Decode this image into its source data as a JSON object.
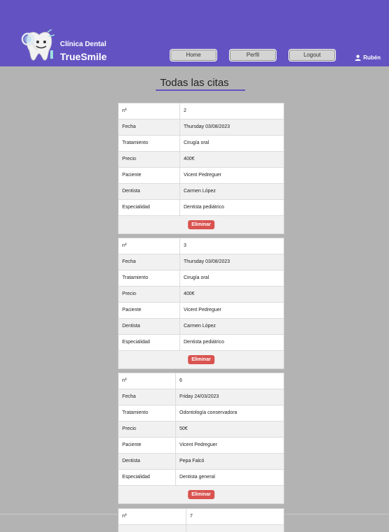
{
  "brand": {
    "line1": "Clínica Dental",
    "line2": "TrueSmile"
  },
  "nav": {
    "home": "Home",
    "profile": "Perfil",
    "logout": "Logout",
    "user": "Rubén"
  },
  "page": {
    "title": "Todas las citas"
  },
  "labels": {
    "num": "nº",
    "date": "Fecha",
    "treatment": "Tratamiento",
    "price": "Precio",
    "patient": "Paciente",
    "dentist": "Dentista",
    "specialty": "Especialidad",
    "delete": "Eliminar"
  },
  "appointments": [
    {
      "num": "2",
      "date": "Thursday 03/08/2023",
      "treatment": "Cirugía oral",
      "price": "400€",
      "patient": "Vicent Pedreguer",
      "dentist": "Carmen López",
      "specialty": "Dentista pediátrico"
    },
    {
      "num": "3",
      "date": "Thursday 03/08/2023",
      "treatment": "Cirugía oral",
      "price": "400€",
      "patient": "Vicent Pedreguer",
      "dentist": "Carmen López",
      "specialty": "Dentista pediátrico"
    },
    {
      "num": "6",
      "date": "Friday 24/03/2023",
      "treatment": "Odontología conservadora",
      "price": "50€",
      "patient": "Vicent Pedreguer",
      "dentist": "Pepa Falcó",
      "specialty": "Dentista general"
    },
    {
      "num": "7"
    }
  ]
}
